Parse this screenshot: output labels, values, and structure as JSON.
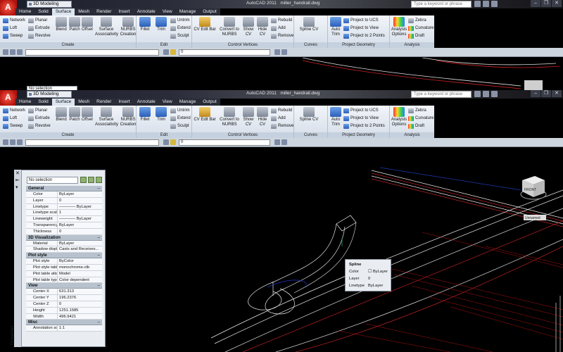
{
  "window": {
    "workspace": "3D Modeling",
    "app_title": "AutoCAD 2011",
    "file_name": "miller_handrail.dwg",
    "search_placeholder": "Type a keyword or phrase",
    "minimize": "–",
    "restore": "❐",
    "close": "✕"
  },
  "tabs": [
    "Home",
    "Solid",
    "Surface",
    "Mesh",
    "Render",
    "Insert",
    "Annotate",
    "View",
    "Manage",
    "Output"
  ],
  "ribbon": {
    "create": {
      "label": "Create",
      "network": "Network",
      "loft": "Loft",
      "sweep": "Sweep",
      "planar": "Planar",
      "extrude": "Extrude",
      "revolve": "Revolve",
      "blend": "Blend",
      "patch": "Patch",
      "offset": "Offset",
      "surface_assoc_1": "Surface",
      "surface_assoc_2": "Associativity",
      "nurbs_1": "NURBS",
      "nurbs_2": "Creation"
    },
    "edit": {
      "label": "Edit",
      "fillet": "Fillet",
      "trim": "Trim",
      "untrim": "Untrim",
      "extend": "Extend",
      "sculpt": "Sculpt"
    },
    "control_vertices": {
      "label": "Control Vertices",
      "cv_edit_bar": "CV Edit Bar",
      "convert_1": "Convert to",
      "convert_2": "NURBS",
      "show_1": "Show",
      "show_2": "CV",
      "hide_1": "Hide",
      "hide_2": "CV",
      "rebuild": "Rebuild",
      "add": "Add",
      "remove": "Remove"
    },
    "curves": {
      "label": "Curves",
      "spline_cv": "Spline CV"
    },
    "project_geometry": {
      "label": "Project Geometry",
      "auto_trim_1": "Auto",
      "auto_trim_2": "Trim",
      "to_ucs": "Project to UCS",
      "to_view": "Project to View",
      "to_2_points": "Project to 2 Points"
    },
    "analysis": {
      "label": "Analysis",
      "options_1": "Analysis",
      "options_2": "Options",
      "zebra": "Zebra",
      "curvature": "Curvature",
      "draft": "Draft"
    }
  },
  "toolbar_row": {
    "layer_value": "0",
    "layer_value_2": "0"
  },
  "properties": {
    "selection": "No selection",
    "palette_title": "Properties",
    "categories": [
      {
        "name": "General",
        "rows": [
          [
            "Color",
            "ByLayer"
          ],
          [
            "Layer",
            "0"
          ],
          [
            "Linetype",
            "———— ByLayer"
          ],
          [
            "Linetype scale",
            "1"
          ],
          [
            "Lineweight",
            "———— ByLayer"
          ],
          [
            "Transparency",
            "ByLayer"
          ],
          [
            "Thickness",
            "0"
          ]
        ]
      },
      {
        "name": "3D Visualization",
        "rows": [
          [
            "Material",
            "ByLayer"
          ],
          [
            "Shadow display",
            "Casts and Receives..."
          ]
        ]
      },
      {
        "name": "Plot style",
        "rows": [
          [
            "Plot style",
            "ByColor"
          ],
          [
            "Plot style table",
            "monochrome.ctb"
          ],
          [
            "Plot table atta...",
            "Model"
          ],
          [
            "Plot table type",
            "Color dependent"
          ]
        ]
      },
      {
        "name": "View",
        "rows": [
          [
            "Center X",
            "631.313"
          ],
          [
            "Center Y",
            "196.2376"
          ],
          [
            "Center Z",
            "0"
          ],
          [
            "Height",
            "1251.1585"
          ],
          [
            "Width",
            "496.9421"
          ]
        ]
      },
      {
        "name": "Misc",
        "rows": [
          [
            "Annotation sc...",
            "1:1"
          ]
        ]
      }
    ]
  },
  "tooltip": {
    "title": "Spline",
    "color_label": "Color",
    "color_value": "ByLayer",
    "layer_label": "Layer",
    "layer_value": "0",
    "linetype_label": "Linetype",
    "linetype_value": "ByLayer"
  },
  "viewcube": {
    "face": "FRONT",
    "wcs": "Unnamed"
  },
  "colors": {
    "ribbon_bg": "#dfe6ef",
    "viewport_bg": "#000000",
    "app_button": "#c01810"
  }
}
